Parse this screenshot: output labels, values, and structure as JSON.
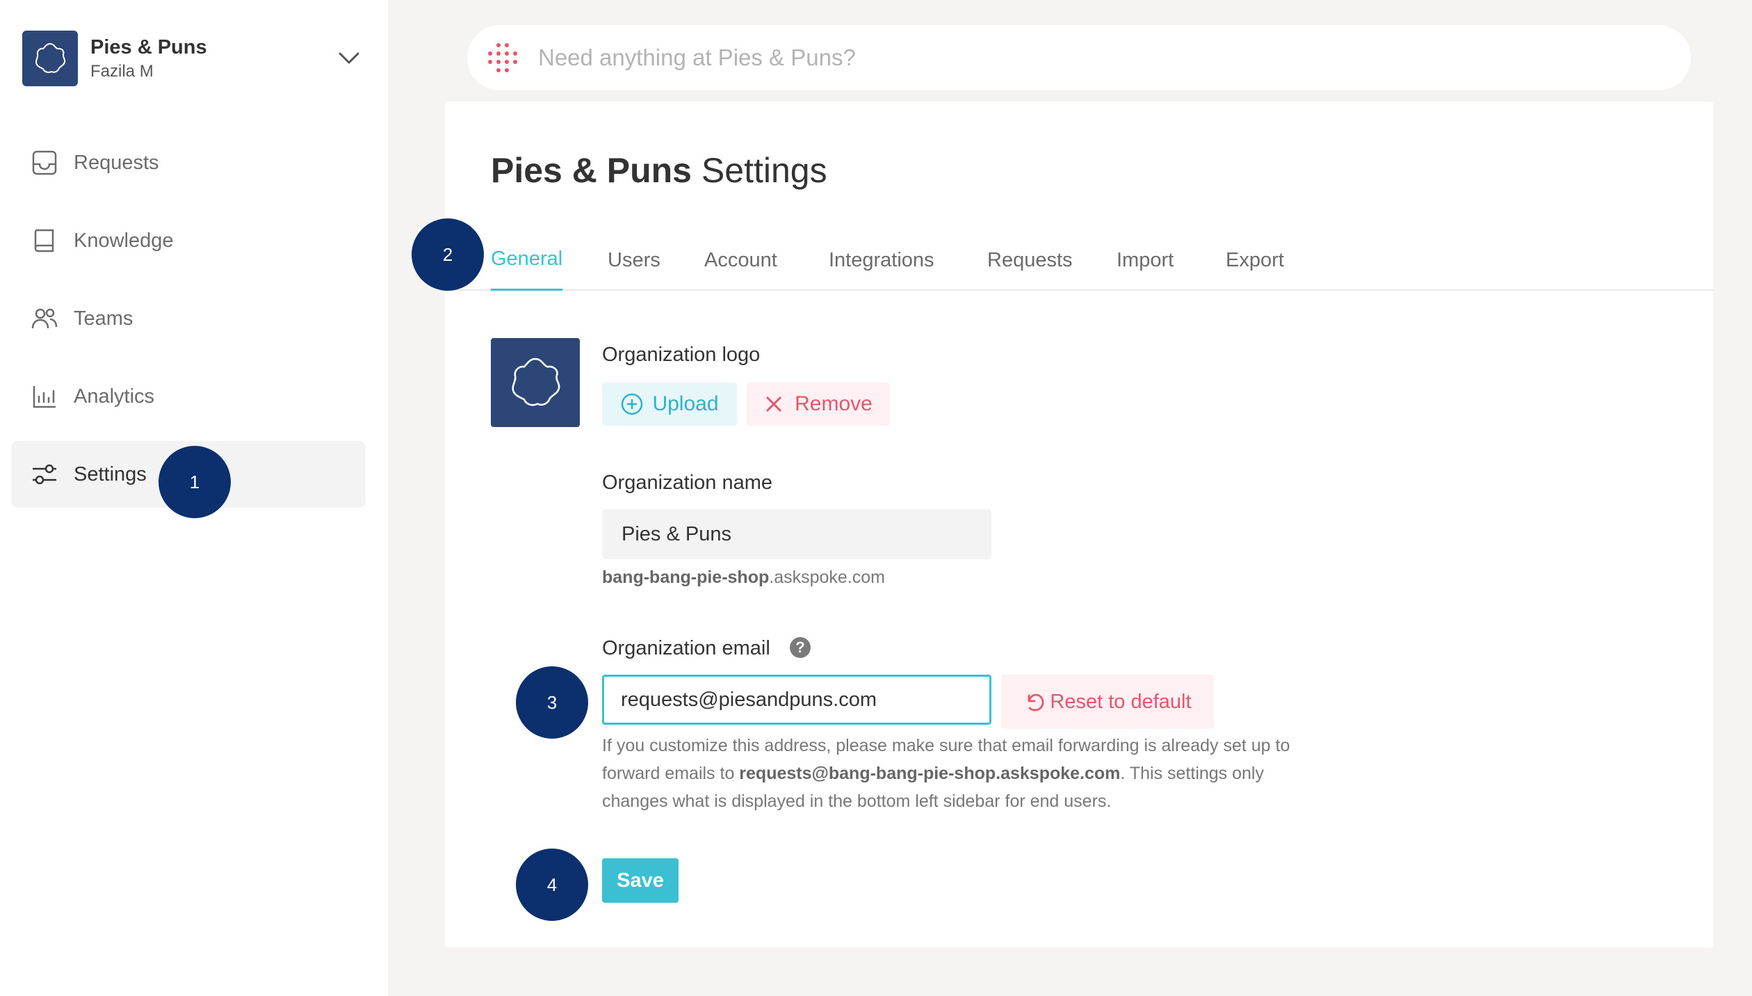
{
  "org": {
    "name": "Pies & Puns",
    "user": "Fazila M"
  },
  "nav": {
    "items": [
      {
        "label": "Requests",
        "icon": "inbox-icon"
      },
      {
        "label": "Knowledge",
        "icon": "book-icon"
      },
      {
        "label": "Teams",
        "icon": "users-icon"
      },
      {
        "label": "Analytics",
        "icon": "bar-chart-icon"
      },
      {
        "label": "Settings",
        "icon": "sliders-icon",
        "active": true
      }
    ]
  },
  "markers": {
    "m1": "1",
    "m2": "2",
    "m3": "3",
    "m4": "4"
  },
  "search": {
    "placeholder": "Need anything at Pies & Puns?"
  },
  "page": {
    "title_org": "Pies & Puns",
    "title_suffix": "Settings"
  },
  "tabs": [
    {
      "label": "General",
      "active": true
    },
    {
      "label": "Users"
    },
    {
      "label": "Account"
    },
    {
      "label": "Integrations"
    },
    {
      "label": "Requests"
    },
    {
      "label": "Import"
    },
    {
      "label": "Export"
    }
  ],
  "general": {
    "logo_label": "Organization logo",
    "upload_label": "Upload",
    "remove_label": "Remove",
    "name_label": "Organization name",
    "name_value": "Pies & Puns",
    "subdomain_bold": "bang-bang-pie-shop",
    "subdomain_suffix": ".askspoke.com",
    "email_label": "Organization email",
    "email_help": "?",
    "email_value": "requests@piesandpuns.com",
    "reset_label": "Reset to default",
    "hint_before": "If you customize this address, please make sure that email forwarding is already set up to forward emails to ",
    "hint_email": "requests@bang-bang-pie-shop.askspoke.com",
    "hint_after": ". This settings only changes what is displayed in the bottom left sidebar for end users.",
    "save_label": "Save"
  },
  "colors": {
    "accent": "#3bbfd3",
    "danger": "#e5566d",
    "brand_navy": "#2c4677",
    "marker_navy": "#0c2f6e"
  }
}
